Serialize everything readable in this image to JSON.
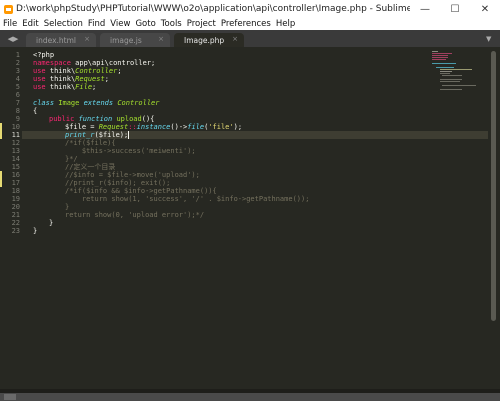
{
  "window": {
    "title": "D:\\work\\phpStudy\\PHPTutorial\\WWW\\o2o\\application\\api\\controller\\Image.php - Sublime Text (UNREGISTERED)",
    "minimize": "—",
    "maximize": "☐",
    "close": "✕"
  },
  "menu": [
    "File",
    "Edit",
    "Selection",
    "Find",
    "View",
    "Goto",
    "Tools",
    "Project",
    "Preferences",
    "Help"
  ],
  "tabs": [
    {
      "label": "index.html",
      "close": "×"
    },
    {
      "label": "image.js",
      "close": "×"
    },
    {
      "label": "Image.php",
      "close": "×"
    }
  ],
  "tab_nav": {
    "prev": "◀",
    "next": "▶",
    "more": "▼"
  },
  "editor": {
    "line_numbers": [
      "1",
      "2",
      "3",
      "4",
      "5",
      "6",
      "7",
      "8",
      "9",
      "10",
      "11",
      "12",
      "13",
      "14",
      "15",
      "16",
      "17",
      "18",
      "19",
      "20",
      "21",
      "22",
      "23"
    ],
    "current_line": 11,
    "modified_lines": [
      10,
      11,
      16,
      17
    ],
    "lines": {
      "l1": {
        "a": "<?php"
      },
      "l2": {
        "kw": "namespace",
        "rest": " app\\api\\controller;"
      },
      "l3": {
        "kw": "use",
        "rest": " think\\",
        "cls": "Controller",
        "end": ";"
      },
      "l4": {
        "kw": "use",
        "rest": " think\\",
        "cls": "Request",
        "end": ";"
      },
      "l5": {
        "kw": "use",
        "rest": " think\\",
        "cls": "File",
        "end": ";"
      },
      "l7": {
        "st1": "class",
        "name": " Image ",
        "st2": "extends",
        "parent": " Controller"
      },
      "l8": {
        "a": "{"
      },
      "l9": {
        "kw": "public",
        "st": " function",
        "fn": " upload",
        "end": "(){"
      },
      "l10": {
        "a": "$file = ",
        "cls": "Request",
        "b": "::",
        "fn1": "instance",
        "c": "()->",
        "fn2": "file",
        "d": "(",
        "str": "'file'",
        "e": ");"
      },
      "l11": {
        "fn": "print_r",
        "a": "($file);"
      },
      "l12": "/*if($file){",
      "l13": "    $this->success('meiwenti');",
      "l14": "}*/",
      "l15": "//定义一个目录",
      "l16": "//$info = $file->move('upload');",
      "l17": "//print_r($info); exit();",
      "l18": "/*if($info && $info->getPathname()){",
      "l19": "    return show(1, 'success', '/' . $info->getPathname());",
      "l20": "}",
      "l21": "return show(0, 'upload error');*/",
      "l22": {
        "a": "}"
      },
      "l23": {
        "a": "}"
      }
    }
  },
  "colors": {
    "editor_bg": "#272822",
    "keyword": "#f92672",
    "storage": "#66d9ef",
    "function": "#a6e22e",
    "string": "#e6db74",
    "comment": "#75715e"
  }
}
